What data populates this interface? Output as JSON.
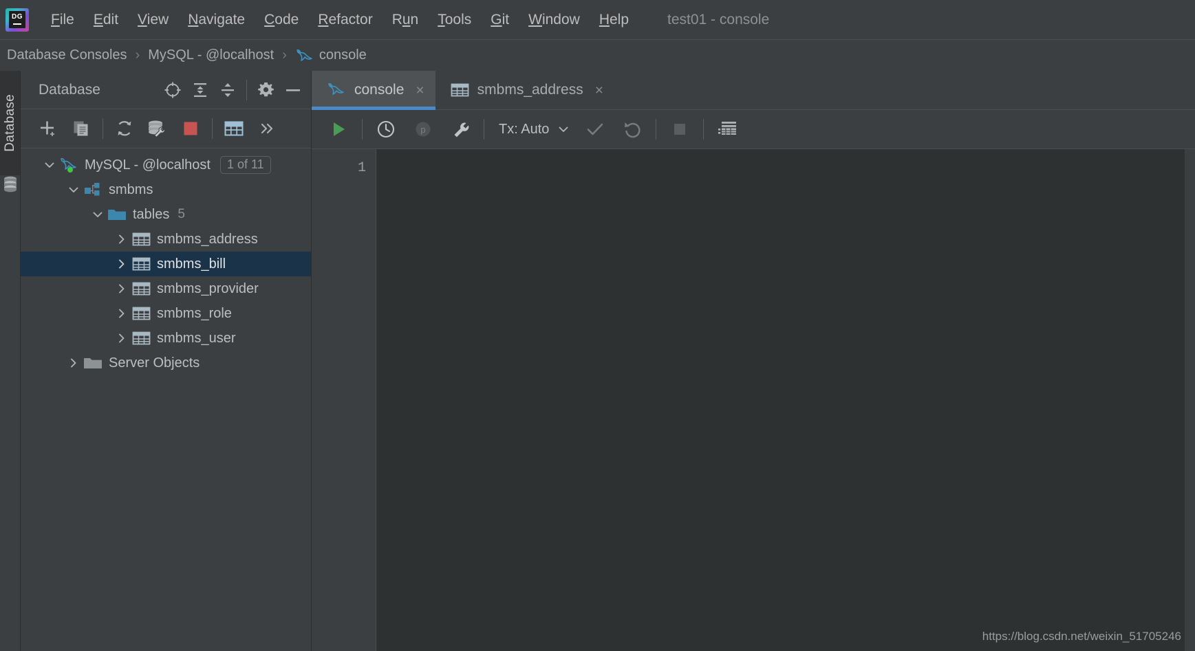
{
  "window": {
    "title": "test01 - console",
    "logo_text": "DG"
  },
  "menubar": {
    "items": [
      {
        "label": "File",
        "mnemonic": "F"
      },
      {
        "label": "Edit",
        "mnemonic": "E"
      },
      {
        "label": "View",
        "mnemonic": "V"
      },
      {
        "label": "Navigate",
        "mnemonic": "N"
      },
      {
        "label": "Code",
        "mnemonic": "C"
      },
      {
        "label": "Refactor",
        "mnemonic": "R"
      },
      {
        "label": "Run",
        "mnemonic": "u"
      },
      {
        "label": "Tools",
        "mnemonic": "T"
      },
      {
        "label": "Git",
        "mnemonic": "G"
      },
      {
        "label": "Window",
        "mnemonic": "W"
      },
      {
        "label": "Help",
        "mnemonic": "H"
      }
    ]
  },
  "breadcrumb": {
    "separator": "›",
    "items": [
      {
        "label": "Database Consoles",
        "icon": ""
      },
      {
        "label": "MySQL - @localhost",
        "icon": ""
      },
      {
        "label": "console",
        "icon": "mysql-dolphin-icon"
      }
    ]
  },
  "toolstrip": {
    "tab_label": "Database",
    "icon": "database-cylinder-icon"
  },
  "database_panel": {
    "title": "Database",
    "header_buttons": [
      {
        "name": "locate-in-tree-button",
        "icon": "crosshair-icon"
      },
      {
        "name": "expand-all-button",
        "icon": "expand-all-icon"
      },
      {
        "name": "collapse-all-button",
        "icon": "collapse-all-icon"
      },
      {
        "name": "settings-button",
        "icon": "gear-icon"
      },
      {
        "name": "hide-panel-button",
        "icon": "minus-icon"
      }
    ],
    "toolbar_buttons": [
      {
        "name": "add-data-source-button",
        "icon": "plus-icon"
      },
      {
        "name": "duplicate-button",
        "icon": "copy-icon"
      },
      {
        "name": "refresh-button",
        "icon": "refresh-icon"
      },
      {
        "name": "database-tools-button",
        "icon": "database-wrench-icon"
      },
      {
        "name": "stop-button",
        "icon": "red-stop-square-icon"
      },
      {
        "name": "jump-to-table-button",
        "icon": "table-grid-icon"
      },
      {
        "name": "more-options-button",
        "icon": "chevron-double-right-icon"
      }
    ]
  },
  "tree": {
    "nodes": [
      {
        "id": "datasource",
        "label": "MySQL - @localhost",
        "icon": "mysql-dolphin-connected-icon",
        "twisty": "chevron-down-icon",
        "indent": 0,
        "badge_box": "1 of 11",
        "selected": false
      },
      {
        "id": "schema",
        "label": "smbms",
        "icon": "schema-icon",
        "twisty": "chevron-down-icon",
        "indent": 1,
        "selected": false
      },
      {
        "id": "tables-folder",
        "label": "tables",
        "icon": "folder-blue-icon",
        "twisty": "chevron-down-icon",
        "indent": 2,
        "count": "5",
        "selected": false
      },
      {
        "id": "smbms_address",
        "label": "smbms_address",
        "icon": "table-icon",
        "twisty": "chevron-right-icon",
        "indent": 3,
        "selected": false
      },
      {
        "id": "smbms_bill",
        "label": "smbms_bill",
        "icon": "table-icon",
        "twisty": "chevron-right-icon",
        "indent": 3,
        "selected": true
      },
      {
        "id": "smbms_provider",
        "label": "smbms_provider",
        "icon": "table-icon",
        "twisty": "chevron-right-icon",
        "indent": 3,
        "selected": false
      },
      {
        "id": "smbms_role",
        "label": "smbms_role",
        "icon": "table-icon",
        "twisty": "chevron-right-icon",
        "indent": 3,
        "selected": false
      },
      {
        "id": "smbms_user",
        "label": "smbms_user",
        "icon": "table-icon",
        "twisty": "chevron-right-icon",
        "indent": 3,
        "selected": false
      },
      {
        "id": "server-objects",
        "label": "Server Objects",
        "icon": "folder-grey-icon",
        "twisty": "chevron-right-icon",
        "indent": 1,
        "selected": false
      }
    ]
  },
  "editor_tabs": [
    {
      "label": "console",
      "icon": "mysql-dolphin-icon",
      "active": true,
      "close": "×"
    },
    {
      "label": "smbms_address",
      "icon": "table-icon",
      "active": false,
      "close": "×"
    }
  ],
  "editor_toolbar": {
    "buttons": [
      {
        "name": "execute-button",
        "icon": "play-green-icon",
        "enabled": true
      },
      {
        "name": "history-button",
        "icon": "clock-icon",
        "enabled": true
      },
      {
        "name": "parameters-button",
        "icon": "circle-p-icon",
        "enabled": false
      },
      {
        "name": "session-settings-button",
        "icon": "wrench-icon",
        "enabled": true
      },
      {
        "name": "commit-button",
        "icon": "checkmark-icon",
        "enabled": false
      },
      {
        "name": "rollback-button",
        "icon": "rollback-arrow-icon",
        "enabled": false
      },
      {
        "name": "stop-query-button",
        "icon": "stop-square-icon",
        "enabled": false
      },
      {
        "name": "data-output-button",
        "icon": "data-output-icon",
        "enabled": true
      }
    ],
    "tx_label": "Tx: Auto"
  },
  "editor": {
    "line_numbers": [
      "1"
    ],
    "content": ""
  },
  "watermark": "https://blog.csdn.net/weixin_51705246",
  "colors": {
    "panel_bg": "#3c3f41",
    "editor_bg": "#2e3132",
    "selection": "#1b3349",
    "accent_blue": "#4a88c7",
    "icon_blue": "#3c93c2",
    "green": "#499c54",
    "red": "#c75450",
    "text": "#bbbbbb"
  }
}
